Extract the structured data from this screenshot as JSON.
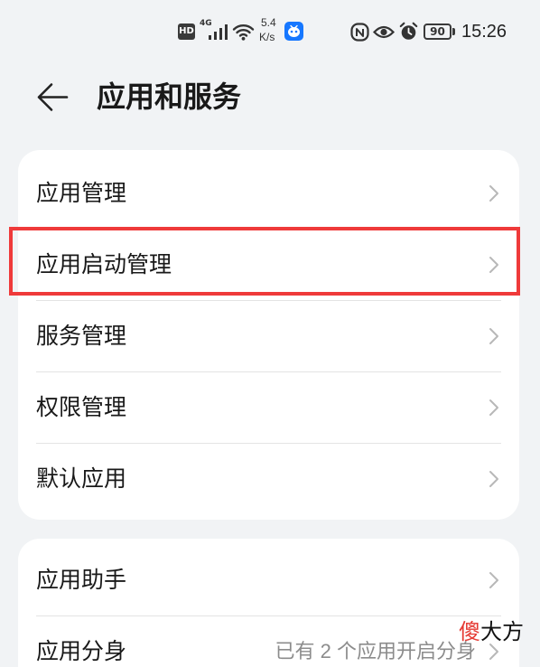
{
  "status_bar": {
    "hd_label": "HD",
    "network_type": "4G",
    "network_speed": {
      "value": "5.4",
      "unit": "K/s"
    },
    "battery_level": "90",
    "time": "15:26",
    "icons": [
      "hd-badge-icon",
      "signal-icon",
      "wifi-icon",
      "app-notification-icon",
      "nfc-icon",
      "eye-comfort-icon",
      "alarm-icon",
      "battery-icon"
    ]
  },
  "header": {
    "back_icon": "arrow-left-icon",
    "title": "应用和服务"
  },
  "groups": [
    {
      "items": [
        {
          "label": "应用管理"
        },
        {
          "label": "应用启动管理",
          "highlighted": true
        },
        {
          "label": "服务管理"
        },
        {
          "label": "权限管理"
        },
        {
          "label": "默认应用"
        }
      ]
    },
    {
      "items": [
        {
          "label": "应用助手"
        },
        {
          "label": "应用分身",
          "value": "已有 2 个应用开启分身"
        }
      ]
    }
  ],
  "row_icon": "chevron-right-icon",
  "watermark": {
    "first": "傻",
    "rest": "大方"
  },
  "colors": {
    "page_background": "#f1f3f5",
    "card_background": "#ffffff",
    "primary_text": "#191919",
    "secondary_text": "#8c8c8c",
    "divider": "#e4e4e4",
    "chevron": "#b8b8b8",
    "highlight_border": "#ef3a3a",
    "watermark_accent": "#e53a33"
  }
}
